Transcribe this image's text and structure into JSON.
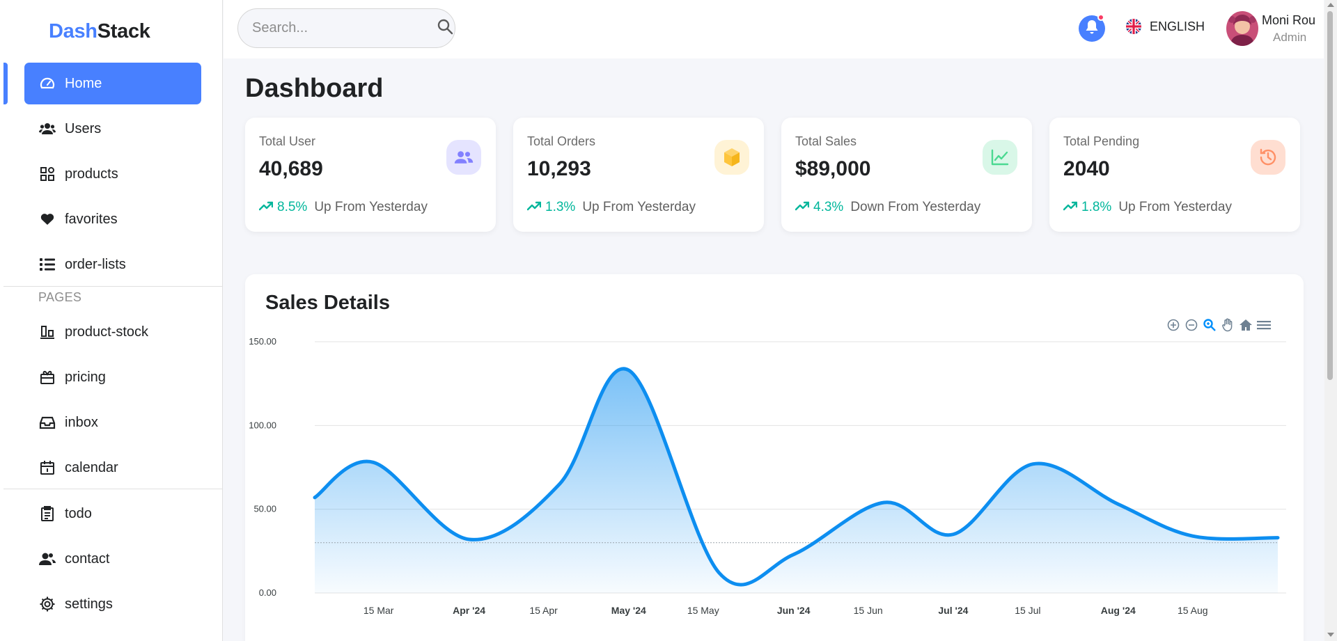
{
  "brand": {
    "part1": "Dash",
    "part2": "Stack"
  },
  "sidebar": {
    "items": [
      {
        "label": "Home",
        "icon": "gauge-icon",
        "active": true
      },
      {
        "label": "Users",
        "icon": "users-icon"
      },
      {
        "label": "products",
        "icon": "grid-icon"
      },
      {
        "label": "favorites",
        "icon": "heart-icon"
      },
      {
        "label": "order-lists",
        "icon": "list-icon"
      }
    ],
    "pages_label": "PAGES",
    "pages": [
      {
        "label": "product-stock",
        "icon": "stock-icon"
      },
      {
        "label": "pricing",
        "icon": "gift-icon"
      },
      {
        "label": "inbox",
        "icon": "inbox-icon"
      },
      {
        "label": "calendar",
        "icon": "calendar-icon"
      }
    ],
    "bottom": [
      {
        "label": "todo",
        "icon": "clipboard-icon"
      },
      {
        "label": "contact",
        "icon": "contact-icon"
      },
      {
        "label": "settings",
        "icon": "gear-icon"
      }
    ]
  },
  "topbar": {
    "search_placeholder": "Search...",
    "language": "ENGLISH",
    "user_name": "Moni Rou",
    "user_role": "Admin"
  },
  "page_title": "Dashboard",
  "cards": [
    {
      "label": "Total User",
      "value": "40,689",
      "pct": "8.5%",
      "trend": "Up From Yesterday",
      "icon": "users-icon",
      "icon_bg": "#e5e4ff",
      "icon_color": "#8280ff"
    },
    {
      "label": "Total Orders",
      "value": "10,293",
      "pct": "1.3%",
      "trend": "Up From Yesterday",
      "icon": "box-icon",
      "icon_bg": "#fff3d6",
      "icon_color": "#fec53d"
    },
    {
      "label": "Total Sales",
      "value": "$89,000",
      "pct": "4.3%",
      "trend": "Down From Yesterday",
      "icon": "chart-line-icon",
      "icon_bg": "#d9f7e8",
      "icon_color": "#4ad991"
    },
    {
      "label": "Total Pending",
      "value": "2040",
      "pct": "1.8%",
      "trend": "Up From Yesterday",
      "icon": "history-icon",
      "icon_bg": "#ffded1",
      "icon_color": "#ff9066"
    }
  ],
  "sales": {
    "title": "Sales Details"
  },
  "chart_data": {
    "type": "area",
    "title": "Sales Details",
    "ylim": [
      0,
      150
    ],
    "y_ticks": [
      "150.00",
      "100.00",
      "50.00",
      "0.00"
    ],
    "x_ticks": [
      {
        "label": "15 Mar",
        "major": false
      },
      {
        "label": "Apr '24",
        "major": true
      },
      {
        "label": "15 Apr",
        "major": false
      },
      {
        "label": "May '24",
        "major": true
      },
      {
        "label": "15 May",
        "major": false
      },
      {
        "label": "Jun '24",
        "major": true
      },
      {
        "label": "15 Jun",
        "major": false
      },
      {
        "label": "Jul '24",
        "major": true
      },
      {
        "label": "15 Jul",
        "major": false
      },
      {
        "label": "Aug '24",
        "major": true
      },
      {
        "label": "15 Aug",
        "major": false
      }
    ],
    "x_domain": [
      "2024-03-03",
      "2024-08-31"
    ],
    "points": [
      {
        "x": "2024-03-03",
        "y": 57
      },
      {
        "x": "2024-03-14",
        "y": 78
      },
      {
        "x": "2024-04-01",
        "y": 32
      },
      {
        "x": "2024-04-18",
        "y": 65
      },
      {
        "x": "2024-05-01",
        "y": 133
      },
      {
        "x": "2024-05-18",
        "y": 12
      },
      {
        "x": "2024-06-01",
        "y": 23
      },
      {
        "x": "2024-06-18",
        "y": 54
      },
      {
        "x": "2024-07-01",
        "y": 35
      },
      {
        "x": "2024-07-16",
        "y": 77
      },
      {
        "x": "2024-08-01",
        "y": 53
      },
      {
        "x": "2024-08-15",
        "y": 34
      },
      {
        "x": "2024-08-31",
        "y": 33
      }
    ],
    "annotation_line_y": 30,
    "line_color": "#0d8ef0",
    "grid": true
  }
}
